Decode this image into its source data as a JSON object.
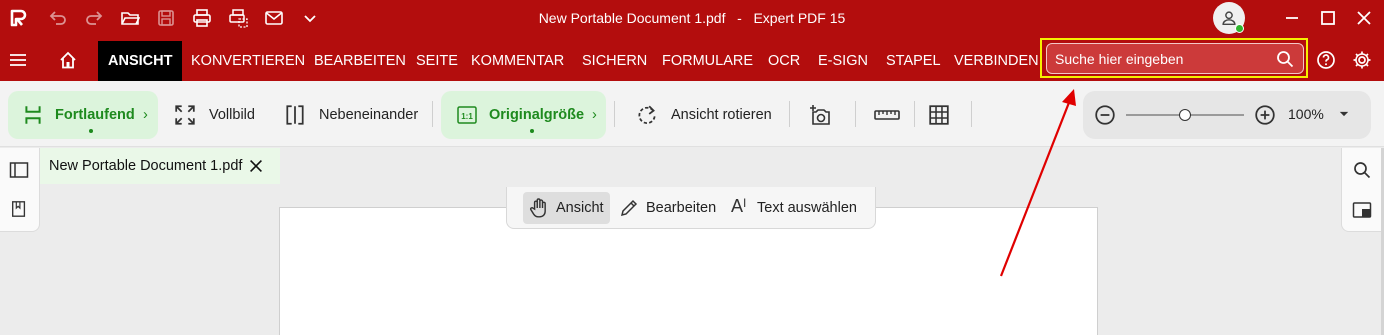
{
  "titlebar": {
    "document_title": "New Portable Document 1.pdf",
    "separator": "-",
    "app_name": "Expert PDF 15"
  },
  "menu": {
    "items": [
      "ANSICHT",
      "KONVERTIEREN",
      "BEARBEITEN",
      "SEITE",
      "KOMMENTAR",
      "SICHERN",
      "FORMULARE",
      "OCR",
      "E-SIGN",
      "STAPEL",
      "VERBINDEN"
    ],
    "active": "ANSICHT"
  },
  "search": {
    "placeholder": "Suche hier eingeben"
  },
  "toolbar": {
    "continuous": "Fortlaufend",
    "fullscreen": "Vollbild",
    "side_by_side": "Nebeneinander",
    "actual_size": "Originalgröße",
    "rotate": "Ansicht rotieren"
  },
  "zoom": {
    "value_label": "100%",
    "level": 0.5
  },
  "tab": {
    "title": "New Portable Document 1.pdf"
  },
  "modes": {
    "view": "Ansicht",
    "edit": "Bearbeiten",
    "select_text": "Text auswählen",
    "active": "view"
  },
  "colors": {
    "brand_red": "#b30d0d",
    "highlight_yellow": "#f5f000",
    "accent_green": "#1e8a1e",
    "arrow_red": "#e00000"
  },
  "icons": [
    "app-logo-icon",
    "undo-icon",
    "redo-icon",
    "open-folder-icon",
    "save-icon",
    "print-icon",
    "scan-icon",
    "email-icon",
    "chevron-down-icon",
    "user-icon",
    "minimize-icon",
    "maximize-icon",
    "close-icon",
    "hamburger-icon",
    "home-icon",
    "search-icon",
    "help-icon",
    "settings-icon"
  ]
}
